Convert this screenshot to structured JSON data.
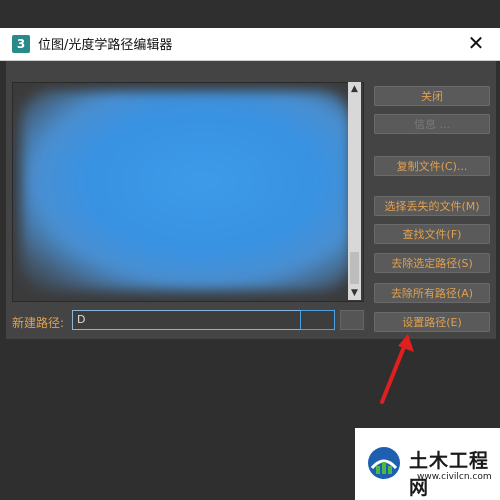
{
  "window": {
    "app_icon_text": "3",
    "title": "位图/光度学路径编辑器",
    "close_glyph": "✕"
  },
  "buttons": {
    "close": "关闭",
    "info": "信息 ...",
    "copy_files": "复制文件(C)...",
    "select_missing": "选择丢失的文件(M)",
    "find_files": "查找文件(F)",
    "strip_selected": "去除选定路径(S)",
    "strip_all": "去除所有路径(A)",
    "set_path": "设置路径(E)"
  },
  "new_path": {
    "label": "新建路径:",
    "value": "D"
  },
  "scroll": {
    "up": "▲",
    "down": "▼"
  },
  "watermark": {
    "name": "土木工程网",
    "url": "www.civilcn.com"
  },
  "colors": {
    "accent_text": "#e0a050",
    "dialog_bg": "#444444",
    "arrow": "#e02020"
  }
}
